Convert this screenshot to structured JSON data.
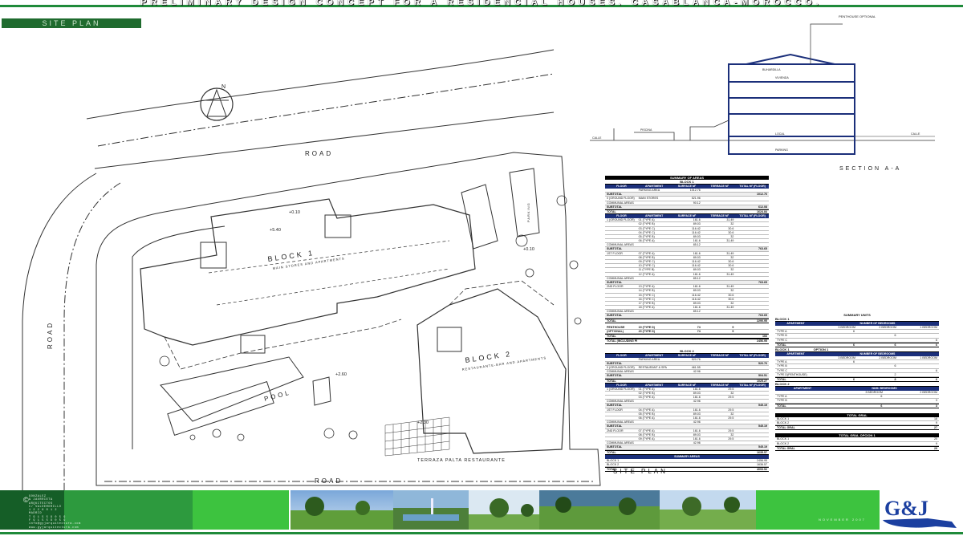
{
  "header": {
    "title": "PRELIMINARY DESIGN CONCEPT FOR A RESIDENCIAL HOUSES. CASABLANCA-MOROCCO.",
    "tag": "SITE PLAN"
  },
  "plan": {
    "road_top": "ROAD",
    "road_left": "ROAD",
    "road_bottom": "ROAD",
    "block1_name": "BLOCK 1",
    "block1_sub": "MAIN STORES AND APARTMENTS",
    "block2_name": "BLOCK 2",
    "block2_sub": "RESTAURANTE-BAR AND APARTMENTS",
    "pool": "POOL",
    "parking": "PARKING",
    "terrace": "TERRAZA PALTA RESTAURANTE",
    "level_top": "+0.10",
    "level_540": "+5.40",
    "level_mid": "+0.10",
    "level_260": "+2.60",
    "level_230": "+2.30",
    "site_plan_label": "SITE PLAN",
    "north": "N"
  },
  "section": {
    "penthouse": "PENTHOUSE OPTIONAL",
    "label": "SECTION A-A",
    "calle_left": "CALLE",
    "calle_right": "CALLE",
    "piscina": "PISCINA",
    "local": "LOCAL",
    "parking": "PARKING",
    "vivienda": "VIVIENDA",
    "buhardilla": "BUHARDILLA"
  },
  "summary_areas": {
    "title": "SUMMARY OF AREAS",
    "headers": [
      "FLOOR",
      "APARTMENT",
      "SURFACE M²",
      "TERRACE M²",
      "TOTAL M² (FLOOR)"
    ],
    "block1": {
      "label": "BLOCK 1",
      "basement": [
        [
          "",
          "PARKING AREA",
          "1012.76",
          "",
          ""
        ],
        [
          "SUBTOTAL",
          "",
          "",
          "",
          "1012.76"
        ],
        [
          "0 (GROUND FLOOR)",
          "MAIN STORES",
          "521.96",
          "",
          ""
        ],
        [
          "COMMUNAL AREAS",
          "",
          "90.12",
          "",
          ""
        ],
        [
          "SUBTOTAL",
          "",
          "",
          "",
          "612.08"
        ],
        [
          "TOTAL",
          "",
          "",
          "",
          "1624.84"
        ]
      ],
      "floors": [
        [
          "1 (GROUND FLOOR)",
          "01 (TYPE A)",
          "161.6",
          "31.49",
          ""
        ],
        [
          "",
          "02 (TYPE B)",
          "89.03",
          "32",
          ""
        ],
        [
          "",
          "03 (TYPE C)",
          "116.42",
          "30.6",
          ""
        ],
        [
          "",
          "04 (TYPE C)",
          "116.42",
          "30.6",
          ""
        ],
        [
          "",
          "05 (TYPE B)",
          "89.03",
          "32",
          ""
        ],
        [
          "",
          "06 (TYPE A)",
          "161.6",
          "31.49",
          ""
        ],
        [
          "COMMUNAL AREAS",
          "",
          "85.12",
          "",
          ""
        ],
        [
          "SUBTOTAL",
          "",
          "",
          "",
          "763.65"
        ],
        [
          "1ST FLOOR",
          "07 (TYPE A)",
          "161.6",
          "31.49",
          ""
        ],
        [
          "",
          "08 (TYPE B)",
          "89.03",
          "32",
          ""
        ],
        [
          "",
          "09 (TYPE C)",
          "116.42",
          "30.6",
          ""
        ],
        [
          "",
          "10 (TYPE C)",
          "116.42",
          "30.6",
          ""
        ],
        [
          "",
          "11 (TYPE B)",
          "89.03",
          "32",
          ""
        ],
        [
          "",
          "12 (TYPE A)",
          "161.6",
          "31.49",
          ""
        ],
        [
          "COMMUNAL AREAS",
          "",
          "85.12",
          "",
          ""
        ],
        [
          "SUBTOTAL",
          "",
          "",
          "",
          "763.65"
        ],
        [
          "2ND FLOOR",
          "13 (TYPE A)",
          "161.6",
          "31.49",
          ""
        ],
        [
          "",
          "14 (TYPE B)",
          "89.03",
          "32",
          ""
        ],
        [
          "",
          "15 (TYPE C)",
          "116.42",
          "30.6",
          ""
        ],
        [
          "",
          "16 (TYPE C)",
          "116.42",
          "30.6",
          ""
        ],
        [
          "",
          "17 (TYPE B)",
          "89.03",
          "32",
          ""
        ],
        [
          "",
          "18 (TYPE A)",
          "161.6",
          "31.49",
          ""
        ],
        [
          "COMMUNAL AREAS",
          "",
          "85.12",
          "",
          ""
        ],
        [
          "SUBTOTAL",
          "",
          "",
          "",
          "763.65"
        ],
        [
          "TOTAL",
          "",
          "",
          "",
          "2290.95"
        ]
      ],
      "penthouse": [
        [
          "PENTHOUSE",
          "19 (TYPE D)",
          "74",
          "9",
          ""
        ],
        [
          "(OPTIONAL)",
          "20 (TYPE D)",
          "74",
          "9",
          ""
        ],
        [
          "TOTAL",
          "",
          "",
          "",
          "166"
        ],
        [
          "TOTAL (INCLUDING PENTHOUSE)",
          "",
          "",
          "",
          "2456.95"
        ]
      ]
    },
    "block2": {
      "label": "BLOCK 2",
      "rows": [
        [
          "",
          "PARKING AREA",
          "520.76",
          "",
          ""
        ],
        [
          "SUBTOTAL",
          "",
          "",
          "",
          "520.76"
        ],
        [
          "0 (GROUND FLOOR)",
          "RESTAURANT & SPA",
          "461.55",
          "",
          ""
        ],
        [
          "COMMUNAL AREAS",
          "",
          "42.96",
          "",
          ""
        ],
        [
          "SUBTOTAL",
          "",
          "",
          "",
          "504.51"
        ],
        [
          "TOTAL",
          "",
          "",
          "",
          "1025.27"
        ]
      ],
      "floors": [
        [
          "1 (GROUND FLOOR)",
          "01 (TYPE A)",
          "161.6",
          "29.5",
          ""
        ],
        [
          "",
          "02 (TYPE B)",
          "89.03",
          "32",
          ""
        ],
        [
          "",
          "03 (TYPE A)",
          "161.6",
          "29.5",
          ""
        ],
        [
          "COMMUNAL AREAS",
          "",
          "42.96",
          "",
          ""
        ],
        [
          "SUBTOTAL",
          "",
          "",
          "",
          "545.19"
        ],
        [
          "1ST FLOOR",
          "04 (TYPE A)",
          "161.6",
          "29.5",
          ""
        ],
        [
          "",
          "05 (TYPE B)",
          "89.03",
          "32",
          ""
        ],
        [
          "",
          "06 (TYPE A)",
          "161.6",
          "29.5",
          ""
        ],
        [
          "COMMUNAL AREAS",
          "",
          "42.96",
          "",
          ""
        ],
        [
          "SUBTOTAL",
          "",
          "",
          "",
          "545.19"
        ],
        [
          "2ND FLOOR",
          "07 (TYPE A)",
          "161.6",
          "29.5",
          ""
        ],
        [
          "",
          "08 (TYPE B)",
          "89.03",
          "32",
          ""
        ],
        [
          "",
          "09 (TYPE A)",
          "161.6",
          "29.5",
          ""
        ],
        [
          "COMMUNAL AREAS",
          "",
          "42.96",
          "",
          ""
        ],
        [
          "SUBTOTAL",
          "",
          "",
          "",
          "545.19"
        ],
        [
          "TOTAL",
          "",
          "",
          "",
          "1635.57"
        ]
      ]
    },
    "summary": {
      "label": "SUMMARY AREAS",
      "rows": [
        [
          "BLOCK 1",
          "",
          "",
          "",
          "2456.95"
        ],
        [
          "BLOCK 2",
          "",
          "",
          "",
          "1636.57"
        ],
        [
          "TOTAL",
          "",
          "",
          "",
          "4093.52"
        ]
      ]
    }
  },
  "summary_units": {
    "title": "SUMMARY UNITS",
    "block1": {
      "label": "BLOCK 1",
      "headers": [
        "APARTMENT",
        "NUMBER OF BEDROOMS"
      ],
      "sub": [
        "",
        "3 BEDROOM",
        "2 BEDROOM",
        "1 BEDROOM"
      ],
      "rows": [
        [
          "TYPE A",
          "6",
          "",
          ""
        ],
        [
          "TYPE B",
          "",
          "6",
          ""
        ],
        [
          "TYPE C",
          "",
          "",
          "6"
        ],
        [
          "TOTAL",
          "6",
          "6",
          "6"
        ]
      ]
    },
    "block1_option": {
      "label": "BLOCK 1",
      "option": "OPTION 1",
      "headers": [
        "APARTMENT",
        "NUMBER OF BEDROOMS"
      ],
      "sub": [
        "",
        "3 BEDROOM",
        "2 BEDROOM",
        "1 BEDROOM"
      ],
      "rows": [
        [
          "TYPE A",
          "6",
          "",
          ""
        ],
        [
          "TYPE B",
          "",
          "6",
          ""
        ],
        [
          "TYPE C",
          "",
          "",
          "6"
        ],
        [
          "TYPE D(PENTHOUSE)",
          "",
          "2",
          ""
        ],
        [
          "TOTAL",
          "6",
          "8",
          "6"
        ]
      ]
    },
    "block2": {
      "label": "BLOCK 2",
      "headers": [
        "APARTMENT",
        "NUM. BEDROOMS"
      ],
      "sub": [
        "",
        "3 BEDROOM",
        "2 BEDROOM"
      ],
      "rows": [
        [
          "TYPE A",
          "6",
          ""
        ],
        [
          "TYPE B",
          "",
          "3"
        ],
        [
          "TOTAL",
          "6",
          "3"
        ]
      ]
    },
    "total_gral": {
      "label": "TOTAL GRAL",
      "rows": [
        [
          "BLOCK 1",
          "18"
        ],
        [
          "BLOCK 2",
          "9"
        ],
        [
          "TOTAL GRAL",
          "27"
        ]
      ]
    },
    "total_option": {
      "label": "TOTAL GRAL OPCION 1",
      "rows": [
        [
          "BLOCK 1",
          "20"
        ],
        [
          "BLOCK 2",
          "9"
        ],
        [
          "TOTAL GRAL",
          "29"
        ]
      ]
    }
  },
  "footer": {
    "copyright": "©",
    "contact": [
      "GONZALEZ",
      "& JAURRIETA",
      "ARQUITECTOS",
      "C/ VALDEMORILLO",
      "1 2 2 8 0 1 2",
      "MADRID",
      "T 9 1 5 5 9 0 5 9",
      "F 9 1 5 5 9 0 5 9",
      "info@gyjarquitectura.com",
      "www.gyjarquitectura.com"
    ],
    "date": "NOVEMBER 2007",
    "logo_text": "G&J",
    "logo_sub": "arquitectura",
    "colors": {
      "dark": "#155e27",
      "mid": "#2d9a3e",
      "bright": "#3dc33f",
      "rule": "#1f8a3a"
    }
  }
}
